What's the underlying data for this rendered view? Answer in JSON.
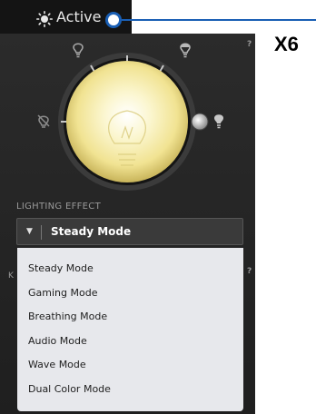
{
  "status": {
    "label": "Active"
  },
  "callout": {
    "text": "X6"
  },
  "help": {
    "mark": "?"
  },
  "lighting": {
    "section_label": "LIGHTING EFFECT",
    "selected": "Steady Mode",
    "arrow": "▼",
    "options": [
      "Steady Mode",
      "Gaming Mode",
      "Breathing Mode",
      "Audio Mode",
      "Wave Mode",
      "Dual Color Mode"
    ]
  },
  "partial_label": "K",
  "colors": {
    "accent": "#1a5fb4",
    "panel": "#262626",
    "menu": "#e7e8ec",
    "bulb": "#f6f0b8"
  }
}
